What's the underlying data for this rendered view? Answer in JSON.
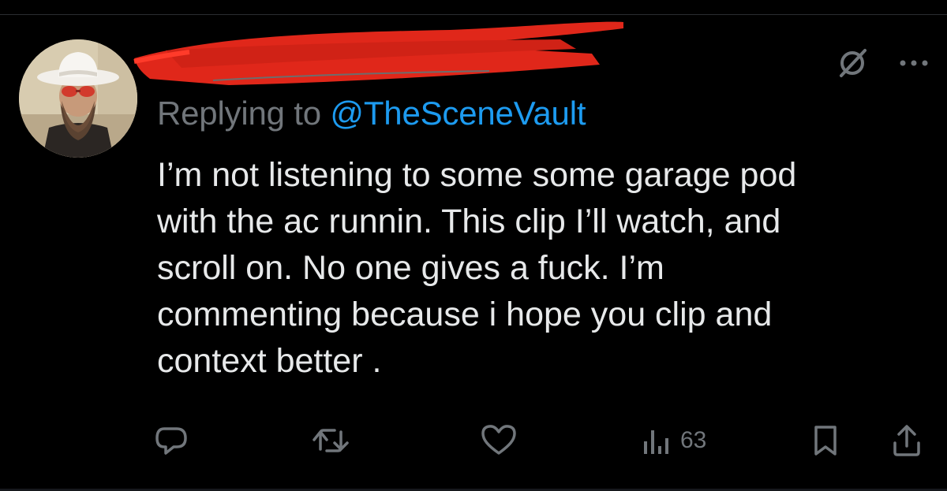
{
  "reply": {
    "prefix": "Replying to ",
    "handle": "@TheSceneVault"
  },
  "tweet": {
    "lines": [
      "I’m not listening to some some garage pod",
      "with the ac runnin. This clip I’ll watch, and",
      "scroll on. No one gives a fuck. I’m",
      "commenting because i hope you clip and",
      "context better ."
    ]
  },
  "actions": {
    "views": "63"
  },
  "icons": {
    "top": [
      "grok-icon",
      "more-icon"
    ],
    "bar": [
      "reply-icon",
      "repost-icon",
      "like-icon",
      "views-icon",
      "bookmark-icon",
      "share-icon"
    ]
  },
  "colors": {
    "background": "#000000",
    "text": "#e7e9ea",
    "muted": "#71767b",
    "link": "#1d9bf0",
    "redaction": "#e0271a"
  }
}
